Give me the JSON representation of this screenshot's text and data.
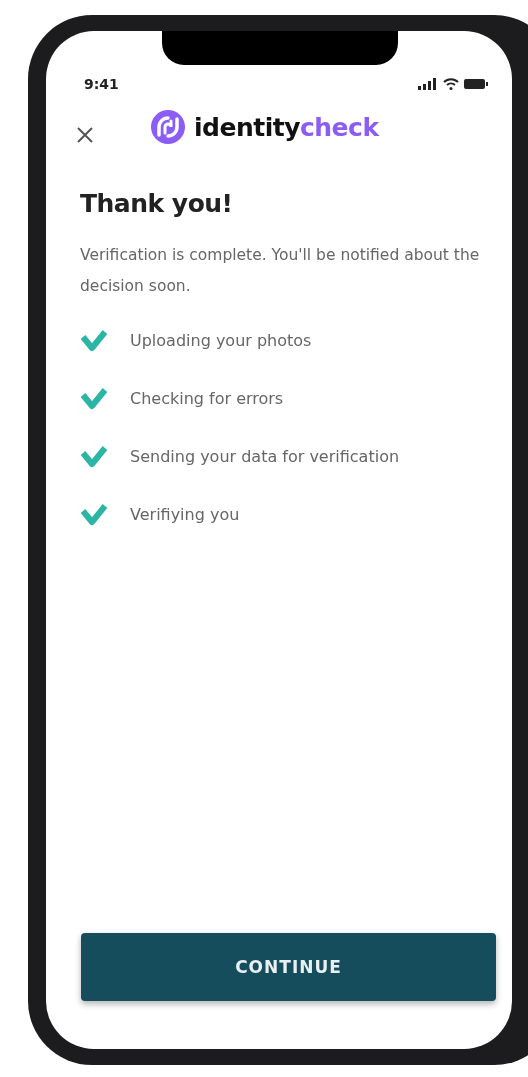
{
  "status_bar": {
    "time": "9:41"
  },
  "header": {
    "logo": {
      "text": "identity",
      "accent": "check"
    }
  },
  "title": "Thank you!",
  "message": "Verification is complete. You'll be notified about the decision soon.",
  "steps": [
    {
      "label": "Uploading your photos",
      "checked": true
    },
    {
      "label": "Checking for errors",
      "checked": true
    },
    {
      "label": "Sending your data for verification",
      "checked": true
    },
    {
      "label": "Verifiying you",
      "checked": true
    }
  ],
  "button": {
    "label": "CONTINUE"
  }
}
